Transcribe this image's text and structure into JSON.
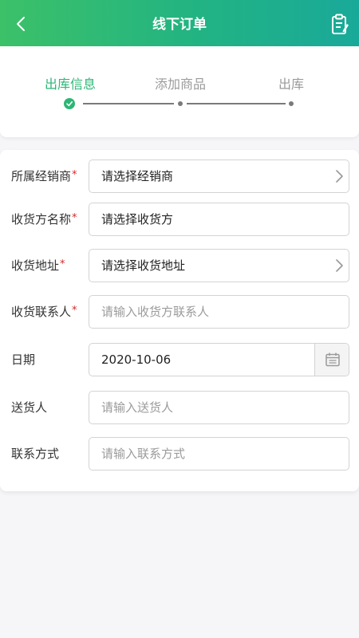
{
  "header": {
    "title": "线下订单",
    "back_icon": "chevron-left-icon",
    "action_icon": "clipboard-icon",
    "gradient": [
      "#3cc168",
      "#19a99a"
    ]
  },
  "steps": [
    {
      "label": "出库信息",
      "state": "done"
    },
    {
      "label": "添加商品",
      "state": "pending"
    },
    {
      "label": "出库",
      "state": "pending"
    }
  ],
  "form": {
    "required_mark": "*",
    "fields": [
      {
        "label": "所属经销商",
        "required": true,
        "value": "请选择经销商",
        "type": "select"
      },
      {
        "label": "收货方名称",
        "required": true,
        "value": "请选择收货方",
        "type": "select"
      },
      {
        "label": "收货地址",
        "required": true,
        "value": "请选择收货地址",
        "type": "select"
      },
      {
        "label": "收货联系人",
        "required": true,
        "placeholder": "请输入收货方联系人",
        "type": "input"
      },
      {
        "label": "日期",
        "required": false,
        "value": "2020-10-06",
        "type": "date"
      },
      {
        "label": "送货人",
        "required": false,
        "placeholder": "请输入送货人",
        "type": "input"
      },
      {
        "label": "联系方式",
        "required": false,
        "placeholder": "请输入联系方式",
        "type": "input"
      }
    ]
  },
  "colors": {
    "accent": "#2cb676",
    "required": "#d62828",
    "placeholder": "#9b9b9b"
  }
}
